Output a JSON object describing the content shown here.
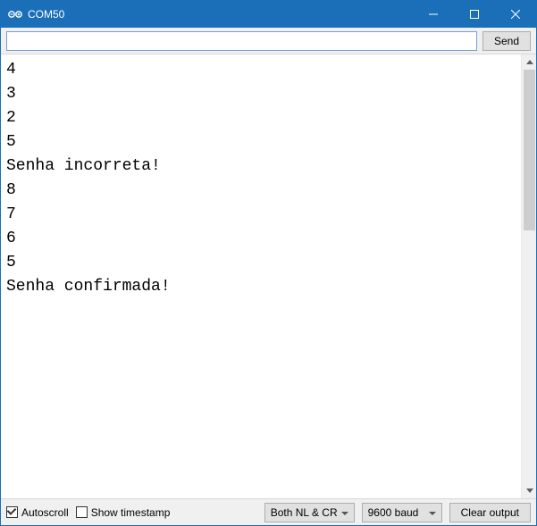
{
  "titlebar": {
    "title": "COM50"
  },
  "input": {
    "value": "",
    "send_label": "Send"
  },
  "output": {
    "lines": "4\n3\n2\n5\nSenha incorreta!\n8\n7\n6\n5\nSenha confirmada!"
  },
  "footer": {
    "autoscroll_label": "Autoscroll",
    "autoscroll_checked": true,
    "timestamp_label": "Show timestamp",
    "timestamp_checked": false,
    "line_ending": "Both NL & CR",
    "baud": "9600 baud",
    "clear_label": "Clear output"
  }
}
